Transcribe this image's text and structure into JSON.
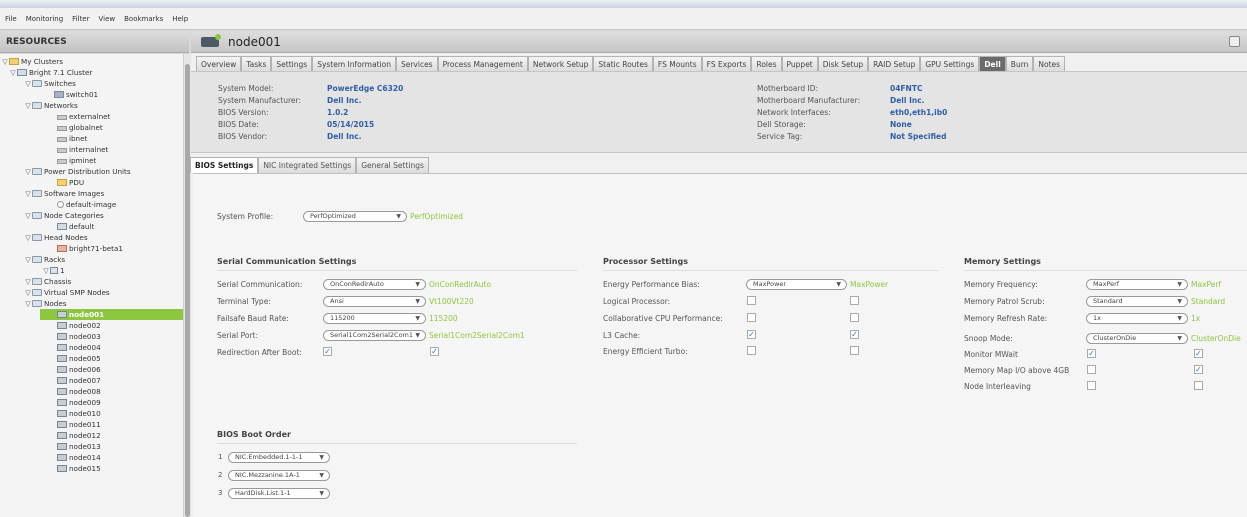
{
  "menu": [
    "File",
    "Monitoring",
    "Filter",
    "View",
    "Bookmarks",
    "Help"
  ],
  "resources_title": "RESOURCES",
  "tree": [
    {
      "label": "My Clusters"
    },
    {
      "label": "Bright 7.1 Cluster"
    },
    {
      "label": "Switches"
    },
    {
      "label": "switch01"
    },
    {
      "label": "Networks"
    },
    {
      "label": "externalnet"
    },
    {
      "label": "globalnet"
    },
    {
      "label": "ibnet"
    },
    {
      "label": "internalnet"
    },
    {
      "label": "ipminet"
    },
    {
      "label": "Power Distribution Units"
    },
    {
      "label": "PDU"
    },
    {
      "label": "Software Images"
    },
    {
      "label": "default-image"
    },
    {
      "label": "Node Categories"
    },
    {
      "label": "default"
    },
    {
      "label": "Head Nodes"
    },
    {
      "label": "bright71-beta1"
    },
    {
      "label": "Racks"
    },
    {
      "label": "1"
    },
    {
      "label": "Chassis"
    },
    {
      "label": "Virtual SMP Nodes"
    },
    {
      "label": "Nodes"
    },
    {
      "label": "node001"
    },
    {
      "label": "node002"
    },
    {
      "label": "node003"
    },
    {
      "label": "node004"
    },
    {
      "label": "node005"
    },
    {
      "label": "node006"
    },
    {
      "label": "node007"
    },
    {
      "label": "node008"
    },
    {
      "label": "node009"
    },
    {
      "label": "node010"
    },
    {
      "label": "node011"
    },
    {
      "label": "node012"
    },
    {
      "label": "node013"
    },
    {
      "label": "node014"
    },
    {
      "label": "node015"
    }
  ],
  "node_title": "node001",
  "tabs": [
    "Overview",
    "Tasks",
    "Settings",
    "System Information",
    "Services",
    "Process Management",
    "Network Setup",
    "Static Routes",
    "FS Mounts",
    "FS Exports",
    "Roles",
    "Puppet",
    "Disk Setup",
    "RAID Setup",
    "GPU Settings",
    "Dell",
    "Burn",
    "Notes"
  ],
  "active_tab": "Dell",
  "info": {
    "system_model_label": "System Model:",
    "system_model": "PowerEdge C6320",
    "system_manufacturer_label": "System Manufacturer:",
    "system_manufacturer": "Dell Inc.",
    "bios_version_label": "BIOS Version:",
    "bios_version": "1.0.2",
    "bios_date_label": "BIOS Date:",
    "bios_date": "05/14/2015",
    "bios_vendor_label": "BIOS Vendor:",
    "bios_vendor": "Dell Inc.",
    "motherboard_id_label": "Motherboard ID:",
    "motherboard_id": "04FNTC",
    "motherboard_manufacturer_label": "Motherboard Manufacturer:",
    "motherboard_manufacturer": "Dell Inc.",
    "network_interfaces_label": "Network Interfaces:",
    "network_interfaces": "eth0,eth1,ib0",
    "dell_storage_label": "Dell Storage:",
    "dell_storage": "None",
    "service_tag_label": "Service Tag:",
    "service_tag": "Not Specified"
  },
  "subtabs": [
    "BIOS Settings",
    "NIC Integrated Settings",
    "General Settings"
  ],
  "system_profile": {
    "label": "System Profile:",
    "value": "PerfOptimized",
    "current": "PerfOptimized"
  },
  "serial": {
    "title": "Serial Communication Settings",
    "comm_label": "Serial Communication:",
    "comm_value": "OnConRedirAuto",
    "comm_current": "OnConRedirAuto",
    "term_label": "Terminal Type:",
    "term_value": "Ansi",
    "term_current": "Vt100Vt220",
    "baud_label": "Failsafe Baud Rate:",
    "baud_value": "115200",
    "baud_current": "115200",
    "port_label": "Serial Port:",
    "port_value": "Serial1Com2Serial2Com1",
    "port_current": "Serial1Com2Serial2Com1",
    "redir_label": "Redirection After Boot:"
  },
  "processor": {
    "title": "Processor Settings",
    "epb_label": "Energy Performance Bias:",
    "epb_value": "MaxPower",
    "epb_current": "MaxPower",
    "logical_label": "Logical Processor:",
    "collab_label": "Collaborative CPU Performance:",
    "l3_label": "L3 Cache:",
    "turbo_label": "Energy Efficient Turbo:"
  },
  "memory": {
    "title": "Memory Settings",
    "freq_label": "Memory Frequency:",
    "freq_value": "MaxPerf",
    "freq_current": "MaxPerf",
    "scrub_label": "Memory Patrol Scrub:",
    "scrub_value": "Standard",
    "scrub_current": "Standard",
    "refresh_label": "Memory Refresh Rate:",
    "refresh_value": "1x",
    "refresh_current": "1x",
    "snoop_label": "Snoop Mode:",
    "snoop_value": "ClusterOnDie",
    "snoop_current": "ClusterOnDie",
    "mwait_label": "Monitor MWait",
    "iomap_label": "Memory Map I/O above 4GB",
    "interleave_label": "Node Interleaving"
  },
  "boot": {
    "title": "BIOS Boot Order",
    "items": [
      {
        "num": "1",
        "value": "NIC.Embedded.1-1-1"
      },
      {
        "num": "2",
        "value": "NIC.Mezzanine.1A-1"
      },
      {
        "num": "3",
        "value": "HardDisk.List.1-1"
      }
    ]
  },
  "colors": {
    "accent": "#8dc63f",
    "value_blue": "#2f5ea7",
    "active_tab": "#6b6b6b"
  }
}
